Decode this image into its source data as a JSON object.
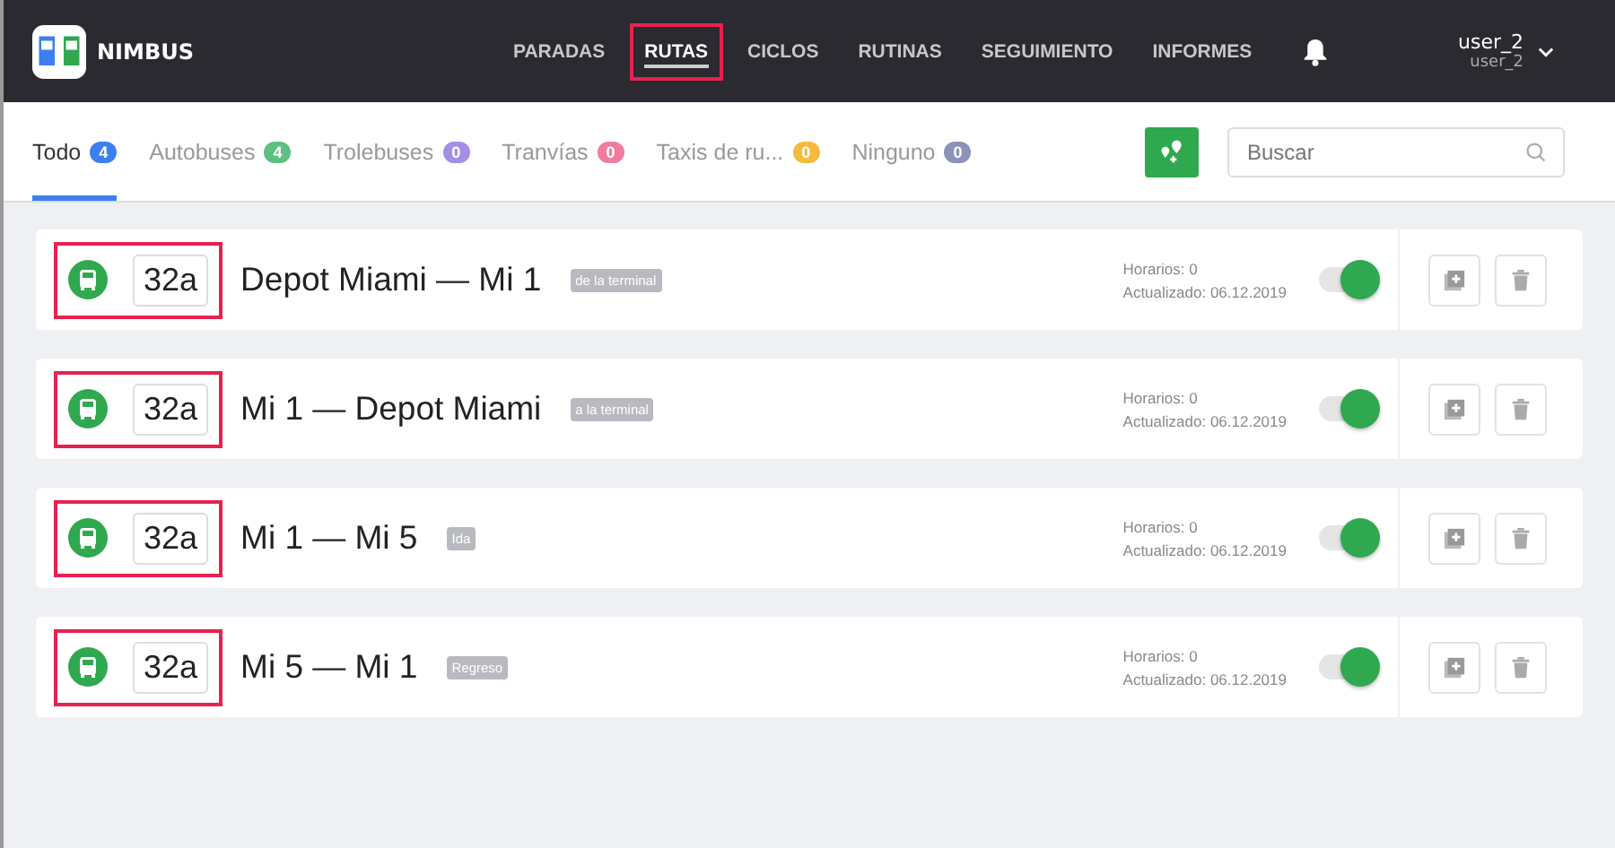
{
  "brand": "NIMBUS",
  "nav": [
    {
      "label": "PARADAS",
      "selected": false,
      "highlighted": false
    },
    {
      "label": "RUTAS",
      "selected": true,
      "highlighted": true
    },
    {
      "label": "CICLOS",
      "selected": false,
      "highlighted": false
    },
    {
      "label": "RUTINAS",
      "selected": false,
      "highlighted": false
    },
    {
      "label": "SEGUIMIENTO",
      "selected": false,
      "highlighted": false
    },
    {
      "label": "INFORMES",
      "selected": false,
      "highlighted": false
    }
  ],
  "user": {
    "name": "user_2",
    "login": "user_2"
  },
  "tabs": [
    {
      "label": "Todo",
      "count": "4",
      "color": "#3d7ff0",
      "selected": true
    },
    {
      "label": "Autobuses",
      "count": "4",
      "color": "#5cc081",
      "selected": false
    },
    {
      "label": "Trolebuses",
      "count": "0",
      "color": "#a38fe8",
      "selected": false
    },
    {
      "label": "Tranvías",
      "count": "0",
      "color": "#f07c9f",
      "selected": false
    },
    {
      "label": "Taxis de ru...",
      "count": "0",
      "color": "#f5bb3d",
      "selected": false
    },
    {
      "label": "Ninguno",
      "count": "0",
      "color": "#8a93b8",
      "selected": false
    }
  ],
  "search": {
    "placeholder": "Buscar"
  },
  "routes": [
    {
      "number": "32a",
      "name": "Depot Miami — Mi 1",
      "tag": "de la terminal",
      "schedules": "Horarios: 0",
      "updated": "Actualizado: 06.12.2019",
      "on": true,
      "highlighted": true
    },
    {
      "number": "32a",
      "name": "Mi 1 — Depot Miami",
      "tag": "a la terminal",
      "schedules": "Horarios: 0",
      "updated": "Actualizado: 06.12.2019",
      "on": true,
      "highlighted": true
    },
    {
      "number": "32a",
      "name": "Mi 1 — Mi 5",
      "tag": "Ida",
      "schedules": "Horarios: 0",
      "updated": "Actualizado: 06.12.2019",
      "on": true,
      "highlighted": true
    },
    {
      "number": "32a",
      "name": "Mi 5 — Mi 1",
      "tag": "Regreso",
      "schedules": "Horarios: 0",
      "updated": "Actualizado: 06.12.2019",
      "on": true,
      "highlighted": true
    }
  ]
}
